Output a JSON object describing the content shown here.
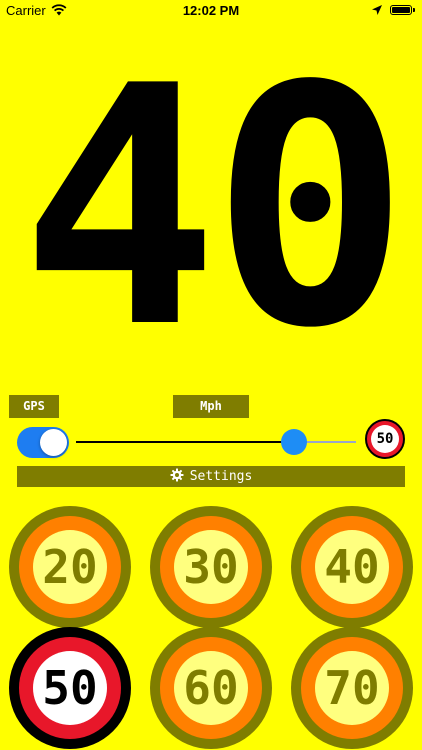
{
  "status_bar": {
    "carrier": "Carrier",
    "time": "12:02 PM"
  },
  "current_speed": "40",
  "labels": {
    "gps": "GPS",
    "unit": "Mph"
  },
  "gps_toggle": {
    "on": true
  },
  "limit_slider": {
    "value": 0.78
  },
  "current_limit_sign": "50",
  "settings_button": {
    "label": "Settings"
  },
  "speed_limit_buttons": [
    {
      "value": "20",
      "selected": false
    },
    {
      "value": "30",
      "selected": false
    },
    {
      "value": "40",
      "selected": false
    },
    {
      "value": "50",
      "selected": true
    },
    {
      "value": "60",
      "selected": false
    },
    {
      "value": "70",
      "selected": false
    }
  ],
  "colors": {
    "background": "#ffff00",
    "accent_blue": "#1e7df1",
    "label_bg": "#7f7d00",
    "sign_red": "#e8172a",
    "sign_orange": "#ff8000",
    "sign_face_inactive": "#ffff7f"
  }
}
